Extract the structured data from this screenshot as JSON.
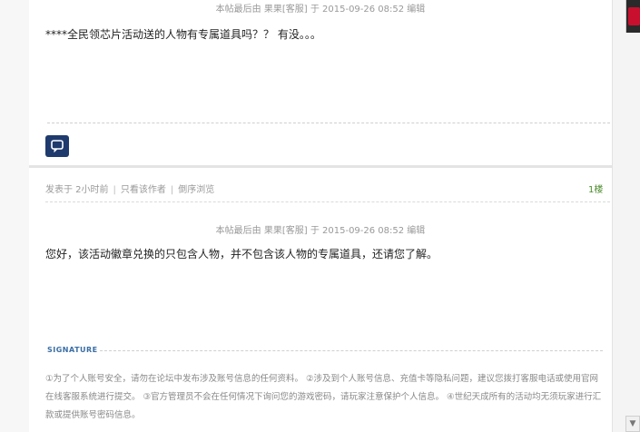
{
  "post1": {
    "edit_note": "本帖最后由 果果[客服] 于 2015-09-26 08:52 编辑",
    "content": "****全民领芯片活动送的人物有专属道具吗？？ 有没。。。"
  },
  "reply_button_icon": "comment-icon",
  "post2": {
    "meta": {
      "posted": "发表于 2小时前",
      "only_author": "只看该作者",
      "reverse": "倒序浏览",
      "separator": "|"
    },
    "floor": "1楼",
    "edit_note": "本帖最后由 果果[客服] 于 2015-09-26 08:52 编辑",
    "content": "您好，该活动徽章兑换的只包含人物，并不包含该人物的专属道具，还请您了解。"
  },
  "signature": {
    "label": "SIGNATURE",
    "text": "①为了个人账号安全，请勿在论坛中发布涉及账号信息的任何资料。 ②涉及到个人账号信息、充值卡等隐私问题，建议您拨打客服电话或使用官网在线客服系统进行提交。 ③官方管理员不会在任何情况下询问您的游戏密码，请玩家注意保护个人信息。 ④世纪天成所有的活动均无须玩家进行汇款或提供账号密码信息。"
  },
  "colors": {
    "accent_blue": "#1f3b6e",
    "floor_green": "#4a8a2a",
    "signature_blue": "#3a6ea5"
  }
}
